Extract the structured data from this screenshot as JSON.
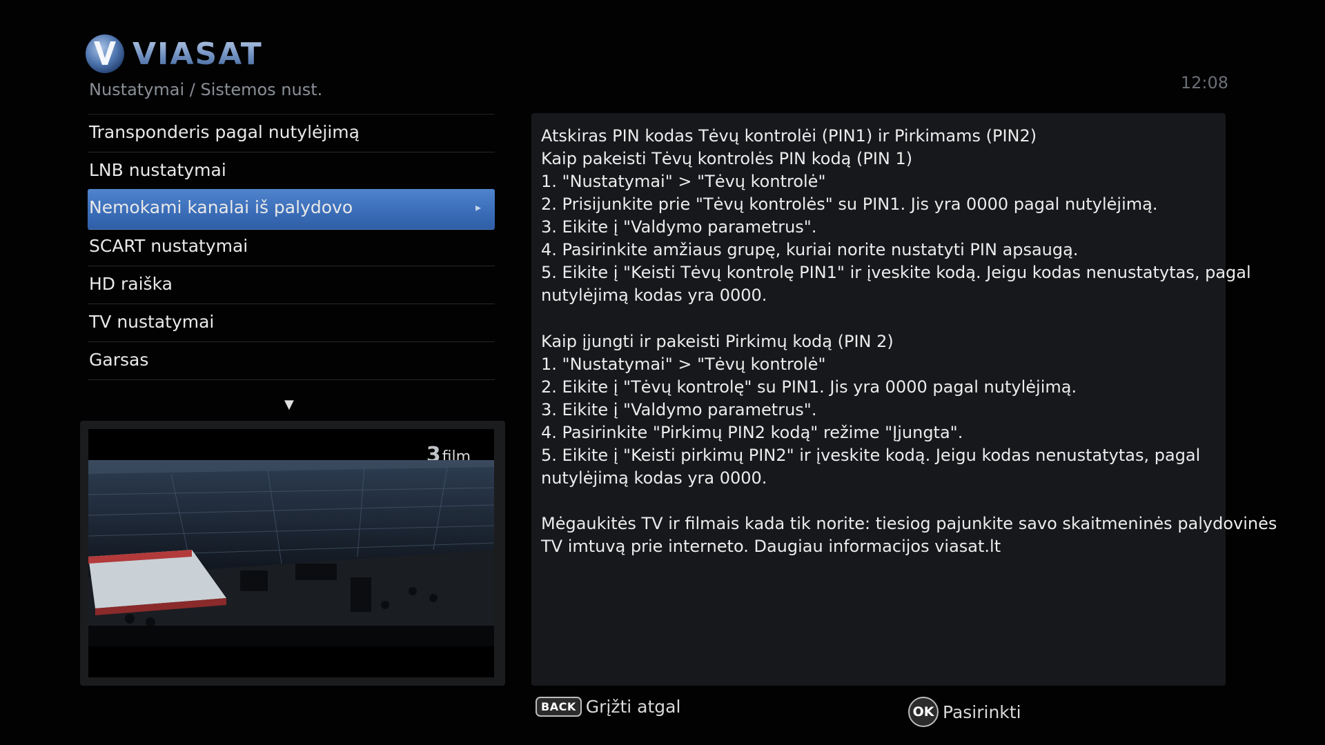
{
  "brand": {
    "name": "VIASAT"
  },
  "header": {
    "breadcrumb": "Nustatymai / Sistemos nust.",
    "clock": "12:08"
  },
  "menu": {
    "items": [
      {
        "label": "Transponderis pagal nutylėjimą"
      },
      {
        "label": "LNB nustatymai"
      },
      {
        "label": "Nemokami kanalai iš palydovo",
        "selected": true
      },
      {
        "label": "SCART nustatymai"
      },
      {
        "label": "HD raiška"
      },
      {
        "label": "TV nustatymai"
      },
      {
        "label": "Garsas"
      }
    ],
    "scroll_indicator": "▼"
  },
  "preview": {
    "channel_number": "3",
    "channel_name": "film"
  },
  "info": {
    "lines": [
      "Atskiras PIN kodas Tėvų kontrolėi (PIN1) ir Pirkimams (PIN2)",
      "Kaip pakeisti Tėvų kontrolės PIN kodą (PIN 1)",
      "1. \"Nustatymai\" > \"Tėvų kontrolė\"",
      "2. Prisijunkite prie \"Tėvų kontrolės\" su PIN1. Jis yra 0000 pagal nutylėjimą.",
      "3. Eikite į \"Valdymo parametrus\".",
      "4. Pasirinkite amžiaus grupę, kuriai norite nustatyti PIN apsaugą.",
      "5. Eikite į \"Keisti Tėvų kontrolę PIN1\" ir įveskite kodą.  Jeigu kodas nenustatytas, pagal",
      "nutylėjimą kodas yra 0000.",
      "Kaip įjungti ir pakeisti Pirkimų kodą (PIN 2)",
      "1. \"Nustatymai\" > \"Tėvų kontrolė\"",
      "2. Eikite į \"Tėvų kontrolę\" su PIN1. Jis yra 0000 pagal nutylėjimą.",
      "3. Eikite į \"Valdymo parametrus\".",
      "4. Pasirinkite \"Pirkimų PIN2 kodą\" režime \"Įjungta\".",
      "5. Eikite į \"Keisti pirkimų PIN2\" ir įveskite kodą. Jeigu kodas nenustatytas, pagal",
      "nutylėjimą kodas yra 0000.",
      "Mėgaukitės TV ir filmais kada tik norite: tiesiog pajunkite savo skaitmeninės palydovinės",
      "TV imtuvą prie interneto. Daugiau informacijos  viasat.lt"
    ]
  },
  "footer": {
    "back_key": "BACK",
    "back_label": "Grįžti atgal",
    "ok_key": "OK",
    "ok_label": "Pasirinkti"
  },
  "colors": {
    "selection": "#3d70bb",
    "panel": "#17181b",
    "background": "#020203"
  }
}
